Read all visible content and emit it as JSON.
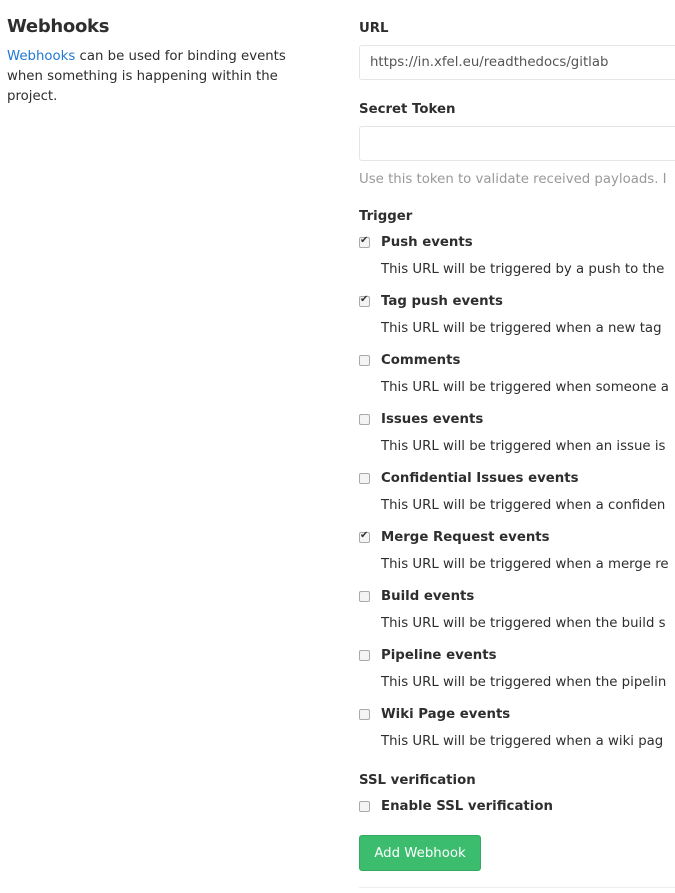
{
  "sidebar": {
    "title": "Webhooks",
    "link_text": "Webhooks",
    "description": " can be used for binding events when something is happening within the project."
  },
  "form": {
    "url_label": "URL",
    "url_value": "https://in.xfel.eu/readthedocs/gitlab",
    "token_label": "Secret Token",
    "token_value": "",
    "token_help": "Use this token to validate received payloads. I",
    "trigger_label": "Trigger",
    "triggers": [
      {
        "label": "Push events",
        "checked": true,
        "description": "This URL will be triggered by a push to the"
      },
      {
        "label": "Tag push events",
        "checked": true,
        "description": "This URL will be triggered when a new tag"
      },
      {
        "label": "Comments",
        "checked": false,
        "description": "This URL will be triggered when someone a"
      },
      {
        "label": "Issues events",
        "checked": false,
        "description": "This URL will be triggered when an issue is"
      },
      {
        "label": "Confidential Issues events",
        "checked": false,
        "description": "This URL will be triggered when a confiden"
      },
      {
        "label": "Merge Request events",
        "checked": true,
        "description": "This URL will be triggered when a merge re"
      },
      {
        "label": "Build events",
        "checked": false,
        "description": "This URL will be triggered when the build s"
      },
      {
        "label": "Pipeline events",
        "checked": false,
        "description": "This URL will be triggered when the pipelin"
      },
      {
        "label": "Wiki Page events",
        "checked": false,
        "description": "This URL will be triggered when a wiki pag"
      }
    ],
    "ssl_label": "SSL verification",
    "ssl_checkbox_label": "Enable SSL verification",
    "ssl_checked": false,
    "submit_label": "Add Webhook"
  },
  "colors": {
    "link": "#1f78d1",
    "button": "#3cbd6e"
  }
}
